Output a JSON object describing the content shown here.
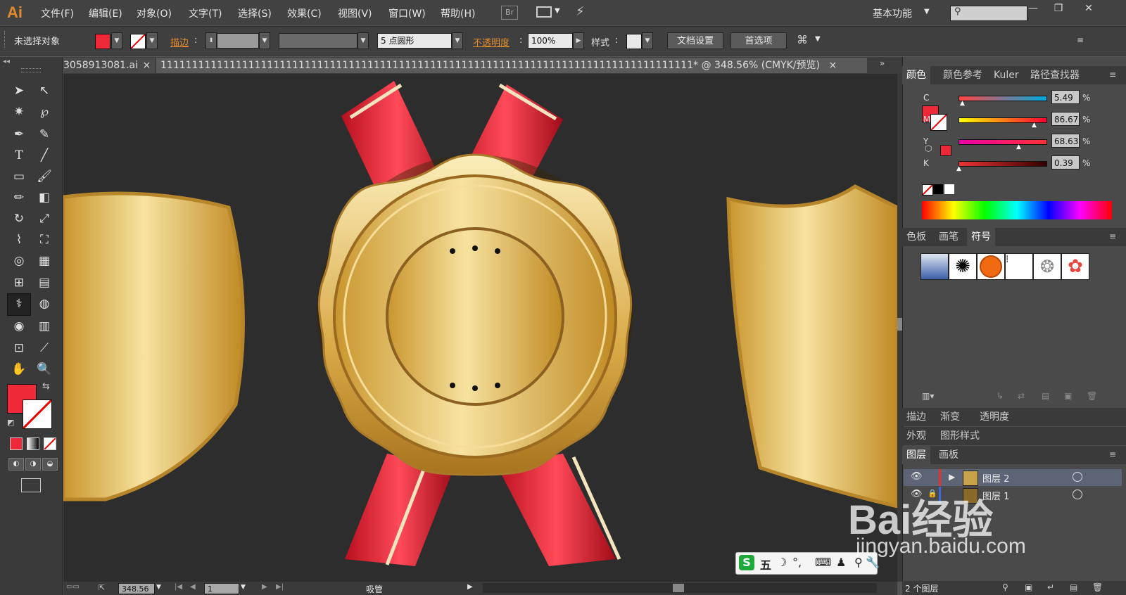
{
  "app": {
    "logo": "Ai",
    "workspace": "基本功能"
  },
  "menu": [
    "文件(F)",
    "编辑(E)",
    "对象(O)",
    "文字(T)",
    "选择(S)",
    "效果(C)",
    "视图(V)",
    "窗口(W)",
    "帮助(H)"
  ],
  "menu_extra": {
    "bridge": "Br"
  },
  "control": {
    "selection": "未选择对象",
    "stroke_label": "描边",
    "brush_value": "5 点圆形",
    "opacity_label": "不透明度",
    "opacity_value": "100%",
    "style_label": "样式",
    "doc_setup": "文档设置",
    "preferences": "首选项"
  },
  "colors": {
    "fill": "#ee2a38",
    "accent": "#e28a2c"
  },
  "tabs": [
    {
      "label": "3058913081.ai",
      "close": "×"
    },
    {
      "label": "1111111111111111111111111111111111111111111111111111111111111111111111111111111111111* @ 348.56% (CMYK/预览)",
      "close": "×"
    }
  ],
  "panels": {
    "color_tabs": [
      "颜色",
      "颜色参考",
      "Kuler",
      "路径查找器"
    ],
    "cmyk": [
      {
        "label": "C",
        "value": "5.49",
        "level": 0.05,
        "unit": "%"
      },
      {
        "label": "M",
        "value": "86.67",
        "level": 0.87,
        "unit": "%"
      },
      {
        "label": "Y",
        "value": "68.63",
        "level": 0.69,
        "unit": "%"
      },
      {
        "label": "K",
        "value": "0.39",
        "level": 0.01,
        "unit": "%"
      }
    ],
    "swatch_tabs": [
      "色板",
      "画笔",
      "符号"
    ],
    "gradient_tabs": [
      "描边",
      "渐变",
      "透明度"
    ],
    "appearance_tabs": [
      "外观",
      "图形样式"
    ],
    "layer_tabs": [
      "图层",
      "画板"
    ],
    "layers": [
      {
        "name": "图层 2"
      },
      {
        "name": "图层 1"
      }
    ],
    "layer_count": "2 个图层"
  },
  "status": {
    "zoom": "348.56",
    "page": "1",
    "tool": "吸管"
  },
  "ime": {
    "label": "五"
  },
  "watermark": {
    "brand": "Bai经验",
    "url": "jingyan.baidu.com"
  }
}
